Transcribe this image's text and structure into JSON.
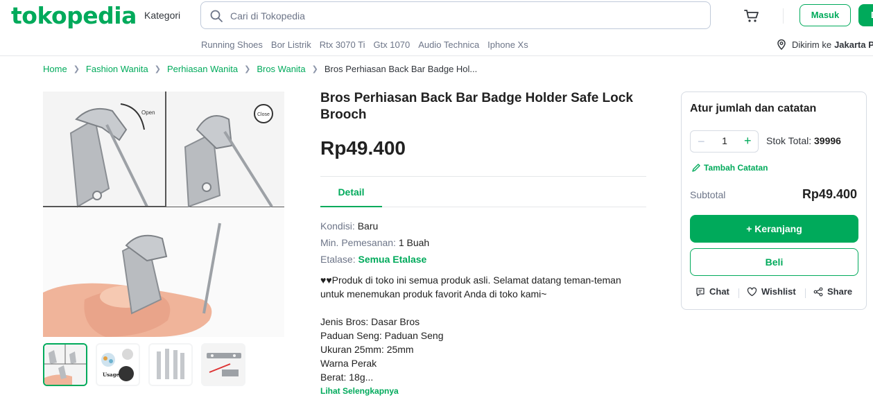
{
  "header": {
    "logo": "tokopedia",
    "kategori": "Kategori",
    "search_placeholder": "Cari di Tokopedia",
    "masuk": "Masuk",
    "daftar": "D",
    "keywords": [
      "Running Shoes",
      "Bor Listrik",
      "Rtx 3070 Ti",
      "Gtx 1070",
      "Audio Technica",
      "Iphone Xs"
    ],
    "location_prefix": "Dikirim ke",
    "location_city": "Jakarta Pu"
  },
  "breadcrumb": {
    "items": [
      "Home",
      "Fashion Wanita",
      "Perhiasan Wanita",
      "Bros Wanita"
    ],
    "current": "Bros Perhiasan Back Bar Badge Hol..."
  },
  "product": {
    "title": "Bros Perhiasan Back Bar Badge Holder Safe Lock Brooch",
    "price": "Rp49.400",
    "tab": "Detail",
    "specs": [
      {
        "label": "Kondisi:",
        "value": "Baru"
      },
      {
        "label": "Min. Pemesanan:",
        "value": "1 Buah"
      },
      {
        "label": "Etalase:",
        "value": "Semua Etalase"
      }
    ],
    "description": [
      "♥♥Produk di toko ini semua produk asli. Selamat datang teman-teman untuk menemukan produk favorit Anda di toko kami~",
      "",
      "Jenis Bros: Dasar Bros",
      "Paduan Seng: Paduan Seng",
      "Ukuran 25mm: 25mm",
      "Warna Perak",
      "Berat: 18g..."
    ],
    "see_more": "Lihat Selengkapnya",
    "image_labels": {
      "open": "Open",
      "close": "Close",
      "usage": "Usage"
    }
  },
  "order": {
    "title": "Atur jumlah dan catatan",
    "quantity": "1",
    "stock_label": "Stok Total:",
    "stock_value": "39996",
    "note": "Tambah Catatan",
    "subtotal_label": "Subtotal",
    "subtotal_value": "Rp49.400",
    "cart_button": "+ Keranjang",
    "buy_button": "Beli",
    "chat": "Chat",
    "wishlist": "Wishlist",
    "share": "Share"
  },
  "colors": {
    "brand": "#00AA5B",
    "text": "#212121",
    "muted": "#6d7588"
  }
}
